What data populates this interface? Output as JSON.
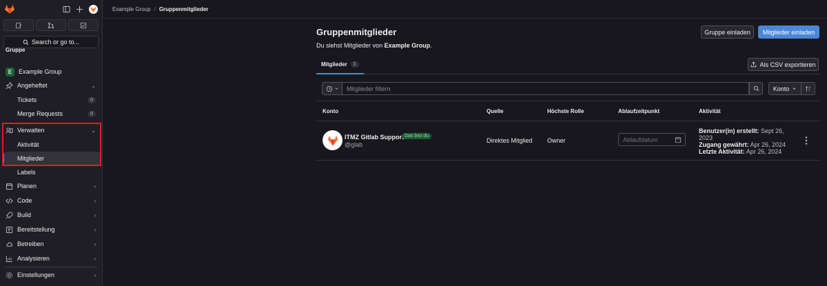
{
  "sidebar": {
    "search_label": "Search or go to...",
    "section_title": "Gruppe",
    "group": {
      "initial": "E",
      "name": "Example Group"
    },
    "items": [
      {
        "label": "Angeheftet",
        "icon": "pin-icon",
        "expanded": true
      },
      {
        "label": "Tickets",
        "count": "0"
      },
      {
        "label": "Merge Requests",
        "count": "0"
      },
      {
        "label": "Verwalten",
        "icon": "users-icon",
        "expanded": true
      },
      {
        "label": "Aktivität"
      },
      {
        "label": "Mitglieder",
        "active": true
      },
      {
        "label": "Labels"
      },
      {
        "label": "Planen",
        "icon": "planning-icon"
      },
      {
        "label": "Code",
        "icon": "code-icon"
      },
      {
        "label": "Build",
        "icon": "rocket-icon"
      },
      {
        "label": "Bereitstellung",
        "icon": "deployments-icon"
      },
      {
        "label": "Betreiben",
        "icon": "cloud-icon"
      },
      {
        "label": "Analysieren",
        "icon": "chart-icon"
      },
      {
        "label": "Einstellungen",
        "icon": "gear-icon"
      }
    ],
    "chevron_down": "⌄",
    "chevron_right": "›"
  },
  "breadcrumb": {
    "group": "Example Group",
    "separator": "/",
    "current": "Gruppenmitglieder"
  },
  "main": {
    "title": "Gruppenmitglieder",
    "subtitle_prefix": "Du siehst Mitglieder von",
    "subtitle_group": "Example Group",
    "subtitle_suffix": ".",
    "invite_group_label": "Gruppe einladen",
    "invite_members_label": "Mitglieder einladen",
    "tab_label": "Mitglieder",
    "tab_count": "1",
    "export_label": "Als CSV exportieren",
    "filter_placeholder": "Mitglieder filtern",
    "sort_label": "Konto"
  },
  "table": {
    "headers": [
      "Konto",
      "Quelle",
      "Höchste Rolle",
      "Ablaufzeitpunkt",
      "Aktivität"
    ],
    "rows": [
      {
        "name": "ITMZ Gitlab Support",
        "badge": "Das bist du",
        "handle": "@glab",
        "source": "Direktes Mitglied",
        "role": "Owner",
        "expiry_placeholder": "Ablaufdatum",
        "activity": [
          {
            "label": "Benutzer(in) erstellt:",
            "value": "Sept 26, 2023"
          },
          {
            "label": "Zugang gewährt:",
            "value": "Apr 26, 2024"
          },
          {
            "label": "Letzte Aktivität:",
            "value": "Apr 26, 2024"
          }
        ]
      }
    ]
  },
  "colors": {
    "accent": "#4a87d7",
    "highlight": "#e3192a",
    "background": "#18171d"
  }
}
